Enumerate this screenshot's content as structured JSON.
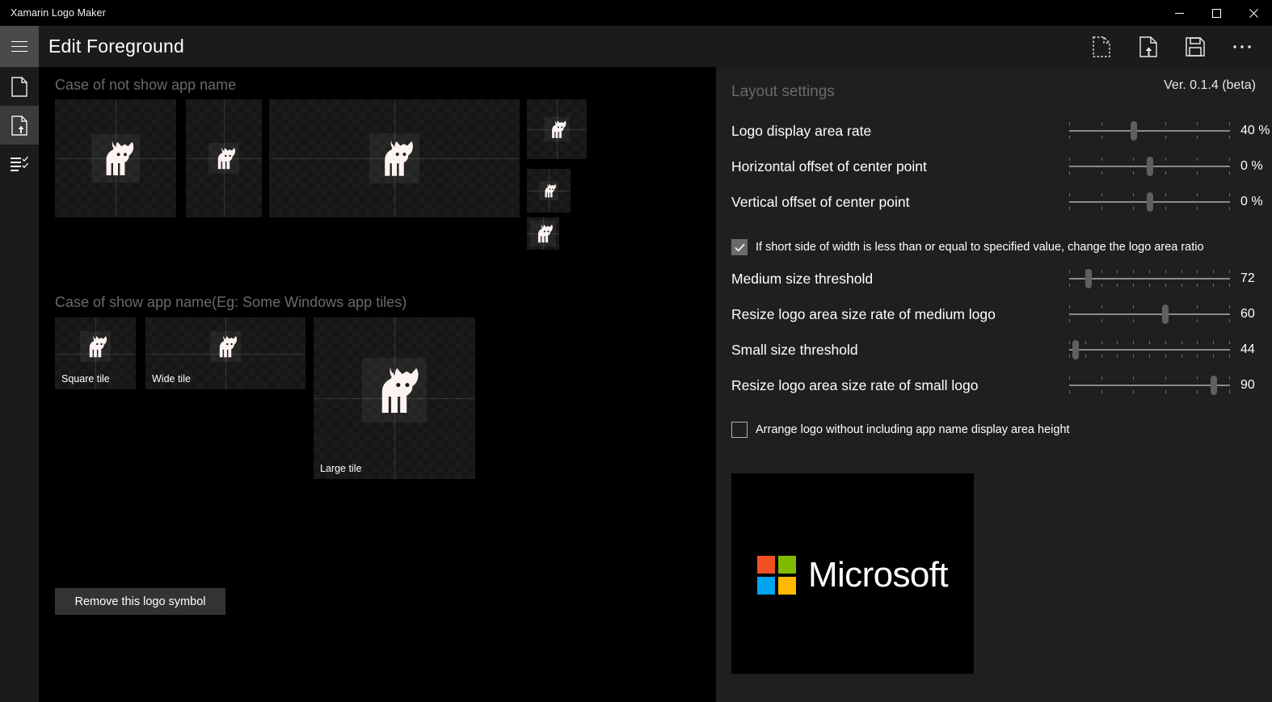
{
  "window": {
    "title": "Xamarin Logo Maker",
    "controls": [
      {
        "name": "minimize",
        "glyph": "minimize-icon"
      },
      {
        "name": "maximize",
        "glyph": "maximize-icon"
      },
      {
        "name": "close",
        "glyph": "close-icon"
      }
    ]
  },
  "header": {
    "menu_icon": "hamburger-icon",
    "title": "Edit Foreground",
    "commands": [
      {
        "name": "new-file",
        "icon": "new-file-icon"
      },
      {
        "name": "import-file",
        "icon": "import-file-icon"
      },
      {
        "name": "save-file",
        "icon": "save-icon"
      },
      {
        "name": "more-options",
        "icon": "more-icon"
      }
    ]
  },
  "rail": {
    "items": [
      {
        "name": "document",
        "icon": "page-icon",
        "active": false
      },
      {
        "name": "foreground",
        "icon": "page-upload-icon",
        "active": true
      },
      {
        "name": "checklist",
        "icon": "list-check-icon",
        "active": false
      }
    ]
  },
  "content": {
    "section_no_name": {
      "heading": "Case of not show app name",
      "tiles": [
        {
          "name": "tile-large-square",
          "label": ""
        },
        {
          "name": "tile-small-square",
          "label": ""
        },
        {
          "name": "tile-wide",
          "label": ""
        },
        {
          "name": "tile-stack-1",
          "label": ""
        },
        {
          "name": "tile-stack-2",
          "label": ""
        },
        {
          "name": "tile-stack-3",
          "label": ""
        }
      ]
    },
    "section_with_name": {
      "heading": "Case of show app name(Eg: Some Windows app tiles)",
      "tiles": [
        {
          "name": "tile-square",
          "label": "Square tile"
        },
        {
          "name": "tile-wide",
          "label": "Wide tile"
        },
        {
          "name": "tile-large",
          "label": "Large tile"
        }
      ]
    },
    "remove_button": "Remove this logo symbol"
  },
  "panel": {
    "title": "Layout settings",
    "version": "Ver. 0.1.4 (beta)",
    "settings": [
      {
        "label": "Logo display area rate",
        "value": 40,
        "display": "40 %",
        "percent": 40,
        "ticks": 6
      },
      {
        "label": "Horizontal offset of center point",
        "value": 0,
        "display": "0 %",
        "percent": 50,
        "ticks": 6
      },
      {
        "label": "Vertical offset of center point",
        "value": 0,
        "display": "0 %",
        "percent": 50,
        "ticks": 6
      }
    ],
    "threshold_checkbox": {
      "label": "If short side of width is less than or equal to specified value, change the logo area ratio",
      "checked": true
    },
    "threshold_settings": [
      {
        "label": "Medium size threshold",
        "value": 72,
        "display": "72",
        "percent": 12,
        "ticks": 11
      },
      {
        "label": "Resize logo area size rate of medium logo",
        "value": 60,
        "display": "60",
        "percent": 60,
        "ticks": 6
      },
      {
        "label": "Small size threshold",
        "value": 44,
        "display": "44",
        "percent": 4,
        "ticks": 11
      },
      {
        "label": "Resize logo area size rate of small logo",
        "value": 90,
        "display": "90",
        "percent": 90,
        "ticks": 6
      }
    ],
    "arrange_checkbox": {
      "label": "Arrange logo without including app name display area height",
      "checked": false
    },
    "preview": {
      "name": "Microsoft",
      "colors": {
        "top_left": "#f25022",
        "top_right": "#7fba00",
        "bottom_left": "#00a4ef",
        "bottom_right": "#ffb900",
        "background": "#000000"
      }
    }
  },
  "theme": {
    "window_bg": "#000000",
    "header_bg": "#1b1b1b",
    "panel_bg": "#1f1f1f",
    "accent_rail": "#3b3b3b",
    "button_bg": "#333333",
    "text": "#ffffff",
    "muted_text": "#6a6a6a"
  }
}
